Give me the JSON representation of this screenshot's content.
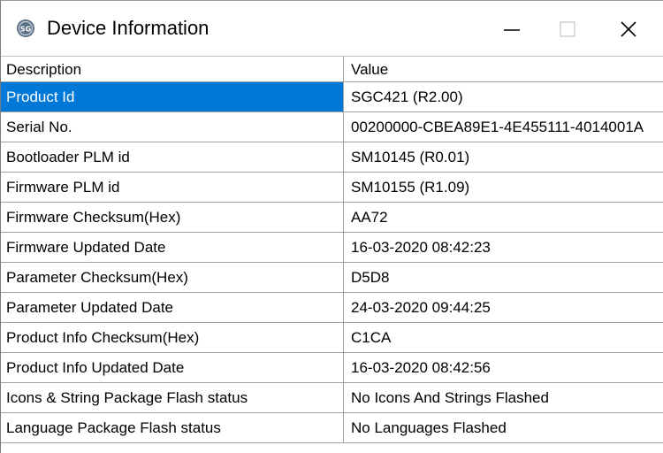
{
  "window": {
    "title": "Device Information",
    "icon": "device-logo-icon",
    "controls": [
      "minimize-icon",
      "maximize-icon",
      "close-icon"
    ]
  },
  "table": {
    "columns": [
      "Description",
      "Value"
    ],
    "rows": [
      {
        "description": "Product Id",
        "value": "SGC421 (R2.00)"
      },
      {
        "description": "Serial No.",
        "value": "00200000-CBEA89E1-4E455111-4014001A"
      },
      {
        "description": "Bootloader PLM id",
        "value": "SM10145 (R0.01)"
      },
      {
        "description": "Firmware PLM id",
        "value": "SM10155 (R1.09)"
      },
      {
        "description": "Firmware Checksum(Hex)",
        "value": "AA72"
      },
      {
        "description": "Firmware Updated Date",
        "value": "16-03-2020 08:42:23"
      },
      {
        "description": "Parameter Checksum(Hex)",
        "value": "D5D8"
      },
      {
        "description": "Parameter Updated Date",
        "value": "24-03-2020 09:44:25"
      },
      {
        "description": "Product Info Checksum(Hex)",
        "value": "C1CA"
      },
      {
        "description": "Product Info Updated Date",
        "value": "16-03-2020 08:42:56"
      },
      {
        "description": "Icons & String Package Flash status",
        "value": "No Icons And Strings Flashed"
      },
      {
        "description": "Language Package Flash status",
        "value": "No Languages Flashed"
      }
    ],
    "selected_row": 0
  },
  "colors": {
    "selection": "#0078d7",
    "grid_line": "#a0a0a0"
  }
}
